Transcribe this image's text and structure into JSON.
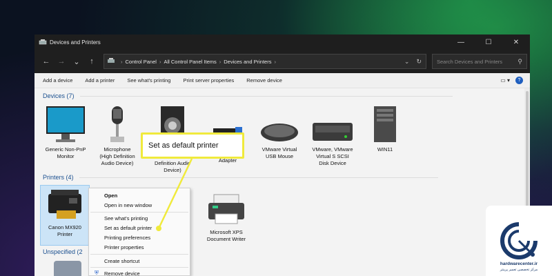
{
  "window": {
    "title": "Devices and Printers",
    "controls": {
      "minimize": "—",
      "maximize": "☐",
      "close": "✕"
    }
  },
  "address": {
    "nav": {
      "back": "←",
      "forward": "→",
      "down": "⌄",
      "up": "↑"
    },
    "breadcrumbs": [
      "Control Panel",
      "All Control Panel Items",
      "Devices and Printers"
    ],
    "search_placeholder": "Search Devices and Printers"
  },
  "commandbar": {
    "items": [
      "Add a device",
      "Add a printer",
      "See what's printing",
      "Print server properties",
      "Remove device"
    ],
    "help": "?"
  },
  "groups": {
    "devices": {
      "label": "Devices (7)"
    },
    "printers": {
      "label": "Printers (4)"
    },
    "unspecified": {
      "label": "Unspecified (2"
    }
  },
  "devices": [
    {
      "name": "Generic Non-PnP\nMonitor",
      "icon": "monitor-icon"
    },
    {
      "name": "Microphone\n(High Definition\nAudio Device)",
      "icon": "microphone-icon"
    },
    {
      "name": "Definition Audio\nDevice)",
      "icon": "speaker-icon"
    },
    {
      "name": "Adapter",
      "icon": "usb-adapter-icon"
    },
    {
      "name": "VMware Virtual\nUSB Mouse",
      "icon": "mouse-icon"
    },
    {
      "name": "VMware, VMware\nVirtual S SCSI\nDisk Device",
      "icon": "disk-icon"
    },
    {
      "name": "WIN11",
      "icon": "computer-icon"
    }
  ],
  "printers": [
    {
      "name": "Canon MX920\nPrinter",
      "icon": "printer-icon",
      "selected": true
    },
    {
      "name": "Microsoft XPS\nDocument Writer",
      "icon": "printer-icon"
    }
  ],
  "context_menu": {
    "items": [
      "Open",
      "Open in new window",
      "See what's printing",
      "Set as default printer",
      "Printing preferences",
      "Printer properties",
      "Create shortcut",
      "Remove device"
    ]
  },
  "callout": {
    "text": "Set as default printer",
    "color": "#f0ea3c"
  },
  "watermark": {
    "site": "hardwarecenter.ir",
    "tagline": "مرکز تخصصی تعمیر پرینتر"
  }
}
